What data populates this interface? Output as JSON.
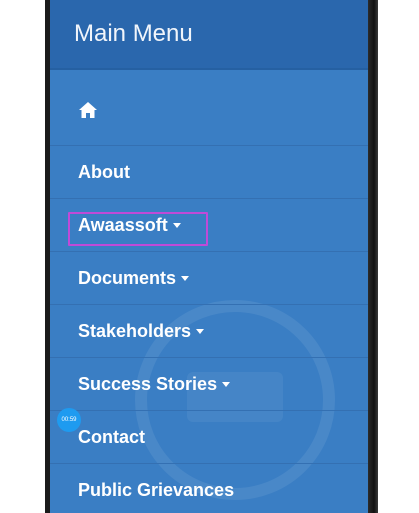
{
  "menu": {
    "title": "Main Menu",
    "items": [
      {
        "label": "",
        "icon": "home-icon"
      },
      {
        "label": "About"
      },
      {
        "label": "Awaassoft",
        "has_dropdown": true,
        "highlighted": true
      },
      {
        "label": "Documents",
        "has_dropdown": true
      },
      {
        "label": "Stakeholders",
        "has_dropdown": true
      },
      {
        "label": "Success Stories",
        "has_dropdown": true
      },
      {
        "label": "Contact"
      },
      {
        "label": "Public Grievances"
      }
    ]
  },
  "overlay": {
    "timer_badge": "00:59"
  },
  "colors": {
    "menu_bg": "#3a7ec4",
    "header_bg": "#2a67ad",
    "highlight_border": "#c04ad8",
    "badge_bg": "#1e9bf0"
  }
}
